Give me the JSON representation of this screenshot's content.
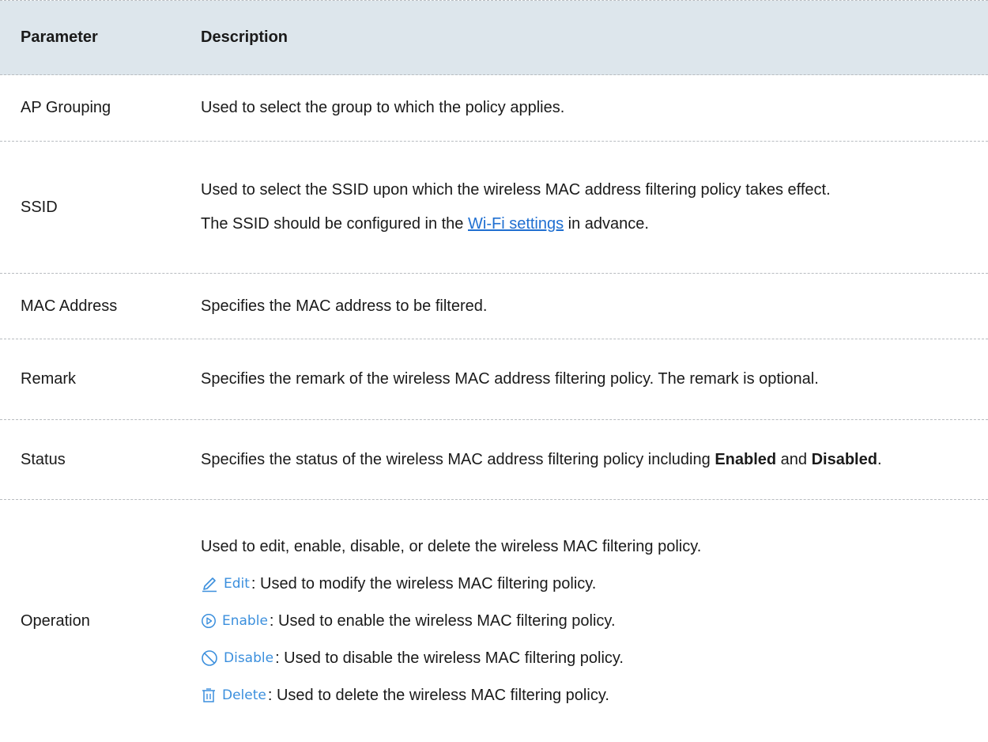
{
  "header": {
    "col1": "Parameter",
    "col2": "Description"
  },
  "rows": {
    "ap_grouping": {
      "param": "AP Grouping",
      "desc": "Used to select the group to which the policy applies."
    },
    "ssid": {
      "param": "SSID",
      "desc1": "Used to select the SSID upon which the wireless MAC address filtering policy takes effect.",
      "desc2_prefix": "The SSID should be configured in the ",
      "desc2_link": "Wi-Fi settings",
      "desc2_suffix": " in advance."
    },
    "mac": {
      "param": "MAC Address",
      "desc": "Specifies the MAC address to be filtered."
    },
    "remark": {
      "param": "Remark",
      "desc": "Specifies the remark of the wireless MAC address filtering policy. The remark is optional."
    },
    "status": {
      "param": "Status",
      "desc_prefix": "Specifies the status of the wireless MAC address filtering policy including ",
      "enabled": "Enabled",
      "and": " and ",
      "disabled": "Disabled",
      "period": "."
    },
    "operation": {
      "param": "Operation",
      "intro": "Used to edit, enable, disable, or delete the wireless MAC filtering policy.",
      "edit_label": "Edit",
      "edit_desc": ": Used to modify the wireless MAC filtering policy.",
      "enable_label": "Enable",
      "enable_desc": ": Used to enable the wireless MAC filtering policy.",
      "disable_label": "Disable",
      "disable_desc": ": Used to disable the wireless MAC filtering policy.",
      "delete_label": "Delete",
      "delete_desc": ": Used to delete the wireless MAC filtering policy."
    }
  },
  "colors": {
    "header_bg": "#dde6ec",
    "link": "#1f6fd1",
    "icon_blue": "#3b8fdd"
  },
  "icons": [
    "pencil-icon",
    "play-circle-icon",
    "ban-circle-icon",
    "trash-icon"
  ]
}
